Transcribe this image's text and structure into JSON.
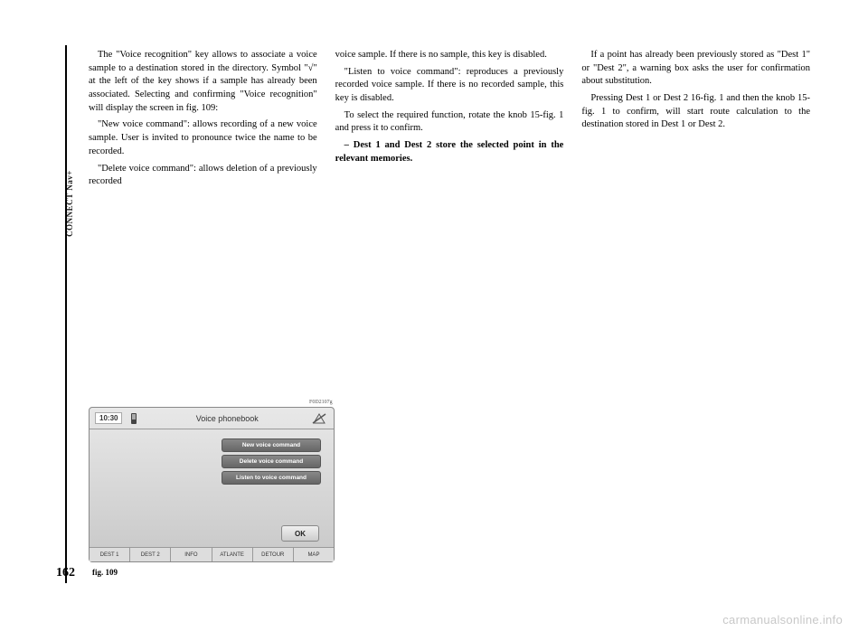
{
  "vertical_label": "CONNECT Nav+",
  "page_number": "162",
  "fig_label": "fig. 109",
  "img_ref": "F0D2107g",
  "watermark": "carmanualsonline.info",
  "col1": {
    "p1": "The \"Voice recognition\" key allows to associate a voice sample to a destination stored in the directory. Symbol \"√\" at the left of the key shows if a sample has already been associated. Selecting and confirming \"Voice recognition\" will display the screen in fig. 109:",
    "p2": "\"New voice command\": allows recording of a new voice sample. User is invited to pronounce twice the name to be recorded.",
    "p3": "\"Delete voice command\": allows deletion of a previously recorded"
  },
  "col2": {
    "p1": "voice sample. If there is no sample, this key is disabled.",
    "p2": "\"Listen to voice command\": reproduces a previously recorded voice sample. If there is no recorded sample, this key is disabled.",
    "p3": "To select the required function, rotate the knob 15-fig. 1 and press it to confirm.",
    "p4": "– Dest 1 and Dest 2 store the selected point in the relevant memories."
  },
  "col3": {
    "p1": "If a point has already been previously stored as \"Dest 1\" or \"Dest 2\", a warning box asks the user for confirmation about substitution.",
    "p2": "Pressing Dest 1 or Dest 2 16-fig. 1 and then the knob 15-fig. 1 to confirm, will start route calculation to the destination stored in Dest 1 or Dest 2."
  },
  "screenshot": {
    "time": "10:30",
    "title": "Voice phonebook",
    "menu": {
      "new": "New voice command",
      "delete": "Delete voice command",
      "listen": "Listen to voice command"
    },
    "ok": "OK",
    "tabs": {
      "dest1": "DEST 1",
      "dest2": "DEST 2",
      "info": "INFO",
      "atlante": "ATLANTE",
      "detour": "DETOUR",
      "map": "MAP"
    }
  }
}
